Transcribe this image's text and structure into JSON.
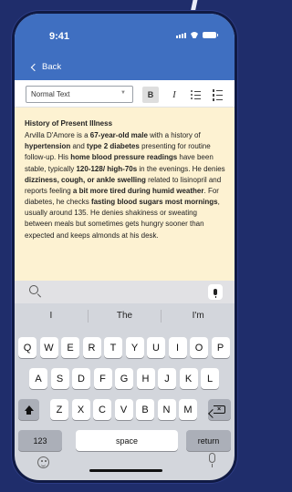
{
  "status_bar": {
    "time": "9:41",
    "icons": [
      "signal-icon",
      "wifi-icon",
      "battery-icon"
    ]
  },
  "nav": {
    "back_label": "Back"
  },
  "toolbar": {
    "text_style": "Normal Text",
    "bold_label": "B",
    "italic_label": "I",
    "icons": [
      "bullet-list-icon",
      "numbered-list-icon"
    ]
  },
  "editor": {
    "heading": "History of Present Illness",
    "segments": [
      {
        "text": "Arvilla D'Amore is a ",
        "bold": false
      },
      {
        "text": "67-year-old male",
        "bold": true
      },
      {
        "text": " with a history of ",
        "bold": false
      },
      {
        "text": "hypertension",
        "bold": true
      },
      {
        "text": " and ",
        "bold": false
      },
      {
        "text": "type 2 diabetes",
        "bold": true
      },
      {
        "text": " presenting for routine follow-up. His ",
        "bold": false
      },
      {
        "text": "home blood pressure readings",
        "bold": true
      },
      {
        "text": " have been stable, typically ",
        "bold": false
      },
      {
        "text": "120-128/ high-70s",
        "bold": true
      },
      {
        "text": " in the evenings. He denies ",
        "bold": false
      },
      {
        "text": "dizziness, cough, or ankle swelling",
        "bold": true
      },
      {
        "text": " related to lisinopril and reports feeling ",
        "bold": false
      },
      {
        "text": "a bit more tired during humid weather",
        "bold": true
      },
      {
        "text": ". For diabetes, he checks ",
        "bold": false
      },
      {
        "text": "fasting blood sugars most mornings",
        "bold": true
      },
      {
        "text": ", usually around 135. He denies shakiness or sweating between meals but sometimes gets hungry sooner than expected and keeps almonds at his desk.",
        "bold": false
      }
    ]
  },
  "keyboard": {
    "predictions": [
      "I",
      "The",
      "I'm"
    ],
    "row1": [
      "Q",
      "W",
      "E",
      "R",
      "T",
      "Y",
      "U",
      "I",
      "O",
      "P"
    ],
    "row2": [
      "A",
      "S",
      "D",
      "F",
      "G",
      "H",
      "J",
      "K",
      "L"
    ],
    "row3": [
      "Z",
      "X",
      "C",
      "V",
      "B",
      "N",
      "M"
    ],
    "numbers_label": "123",
    "space_label": "space",
    "return_label": "return"
  },
  "colors": {
    "header": "#3f6fc1",
    "editor_bg": "#fdf2d2",
    "background": "#1f2d6b"
  }
}
